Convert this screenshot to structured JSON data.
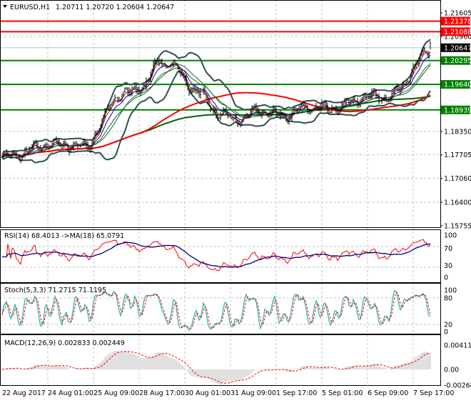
{
  "header": {
    "symbol": "EURUSD,H1",
    "ohlc": "1.20711 1.20720 1.20604 1.20647"
  },
  "colors": {
    "bg": "#ffffff",
    "support": "#008000",
    "resistance": "#ff0000",
    "current": "#000000",
    "bands": "#2f4f4f",
    "ma_slow_red": "#ff0000",
    "ma_slow_green": "#006400",
    "rsi": "#ff0000",
    "rsi_ma": "#000080",
    "stoch_main": "#20b2aa",
    "stoch_signal": "#ff0000",
    "macd_hist": "#c0c0c0",
    "macd_signal": "#ff0000"
  },
  "chart_data": [
    {
      "type": "candlestick",
      "title": "EURUSD,H1",
      "timeframe": "H1",
      "close_approx_every_10_bars": [
        1.1764,
        1.177,
        1.1784,
        1.18,
        1.1798,
        1.1797,
        1.1793,
        1.186,
        1.1935,
        1.1941,
        1.1965,
        1.203,
        1.202,
        1.1965,
        1.1935,
        1.189,
        1.187,
        1.1868,
        1.1895,
        1.188,
        1.188,
        1.19,
        1.1902,
        1.1897,
        1.1908,
        1.1925,
        1.1932,
        1.1925,
        1.1955,
        1.202,
        1.2065
      ],
      "last_bar": {
        "open": 1.20711,
        "high": 1.2072,
        "low": 1.20604,
        "close": 1.20647
      },
      "ylim": [
        1.15755,
        1.21605
      ],
      "y_ticks": [
        "1.21605",
        "1.20960",
        "1.18350",
        "1.17705",
        "1.17060",
        "1.16400",
        "1.15755"
      ],
      "levels": [
        {
          "label": "1.21378",
          "value": 1.21378,
          "kind": "resistance"
        },
        {
          "label": "1.21088",
          "value": 1.21088,
          "kind": "resistance"
        },
        {
          "label": "1.20295",
          "value": 1.20295,
          "kind": "support"
        },
        {
          "label": "1.19640",
          "value": 1.1964,
          "kind": "support"
        },
        {
          "label": "1.18939",
          "value": 1.18939,
          "kind": "support"
        }
      ],
      "current_price": {
        "label": "1.20647",
        "value": 1.20647
      },
      "overlays": [
        "Bollinger Bands",
        "Moving averages"
      ],
      "grid": true
    },
    {
      "type": "line",
      "title": "RSI(14) 68.4013  ->MA(18) 65.0791",
      "ylim": [
        0,
        100
      ],
      "y_ticks": [
        "100",
        "70",
        "30",
        "0"
      ],
      "last_values": {
        "rsi": 68.4013,
        "ma": 65.0791
      }
    },
    {
      "type": "line",
      "title": "Stoch(5,3,3) 71.2715 71.1195",
      "ylim": [
        0,
        100
      ],
      "y_ticks": [
        "100",
        "80",
        "20",
        "0"
      ],
      "last_values": {
        "main": 71.2715,
        "signal": 71.1195
      }
    },
    {
      "type": "bar",
      "title": "MACD(12,26,9) 0.002833 0.002449",
      "ylim": [
        -0.002684,
        0.004113
      ],
      "y_ticks": [
        "0.004113",
        "0.00",
        "-0.002684"
      ],
      "last_values": {
        "macd": 0.002833,
        "signal": 0.002449
      }
    }
  ],
  "time_axis": [
    "22 Aug 2017",
    "24 Aug 01:00",
    "25 Aug 09:00",
    "28 Aug 17:00",
    "30 Aug 01:00",
    "31 Aug 09:00",
    "1 Sep 17:00",
    "5 Sep 01:00",
    "6 Sep 09:00",
    "7 Sep 17:00"
  ]
}
